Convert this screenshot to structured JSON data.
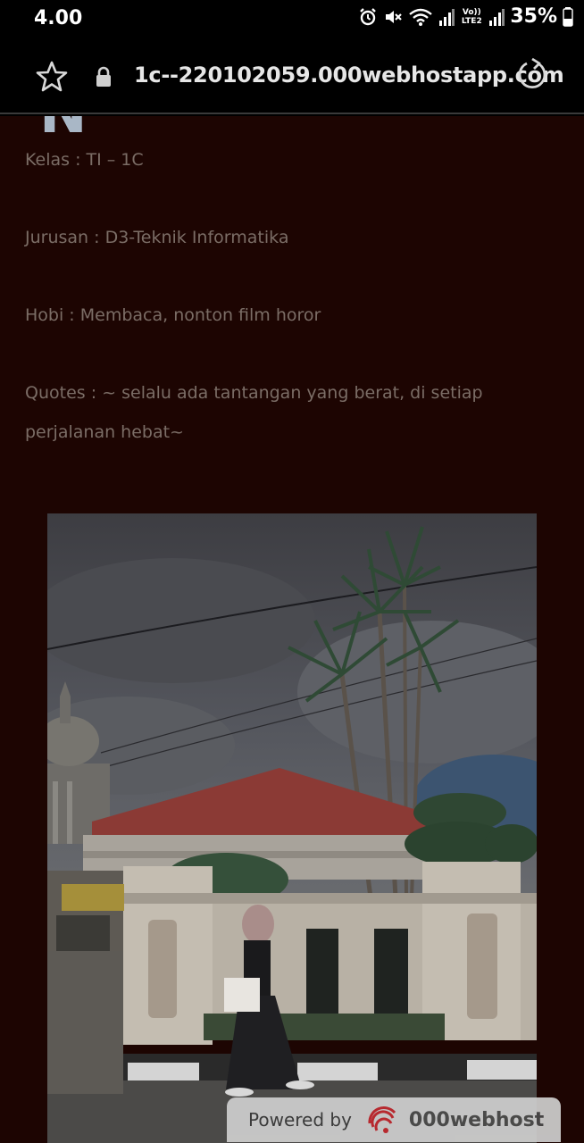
{
  "status_bar": {
    "time": "4.00",
    "battery": "35%",
    "network_label": "Vo)) LTE2",
    "icons": [
      "alarm-icon",
      "mute-icon",
      "wifi-icon",
      "signal-icon",
      "volte-icon",
      "signal-icon",
      "battery-icon"
    ]
  },
  "browser": {
    "url": "1c--220102059.000webhostapp.com",
    "icons": [
      "star-icon",
      "lock-icon",
      "reload-icon"
    ]
  },
  "profile": {
    "heading_fragment": "N",
    "kelas": "Kelas : TI – 1C",
    "jurusan": "Jurusan : D3-Teknik Informatika",
    "hobi": "Hobi : Membaca, nonton film horor",
    "quotes": "Quotes : ~ selalu ada tantangan yang berat, di setiap perjalanan hebat~"
  },
  "footer_badge": {
    "label": "Powered by",
    "brand": "000webhost"
  },
  "colors": {
    "page_background": "#1d0502",
    "text": "#7b6d66",
    "status_background": "#000000"
  }
}
